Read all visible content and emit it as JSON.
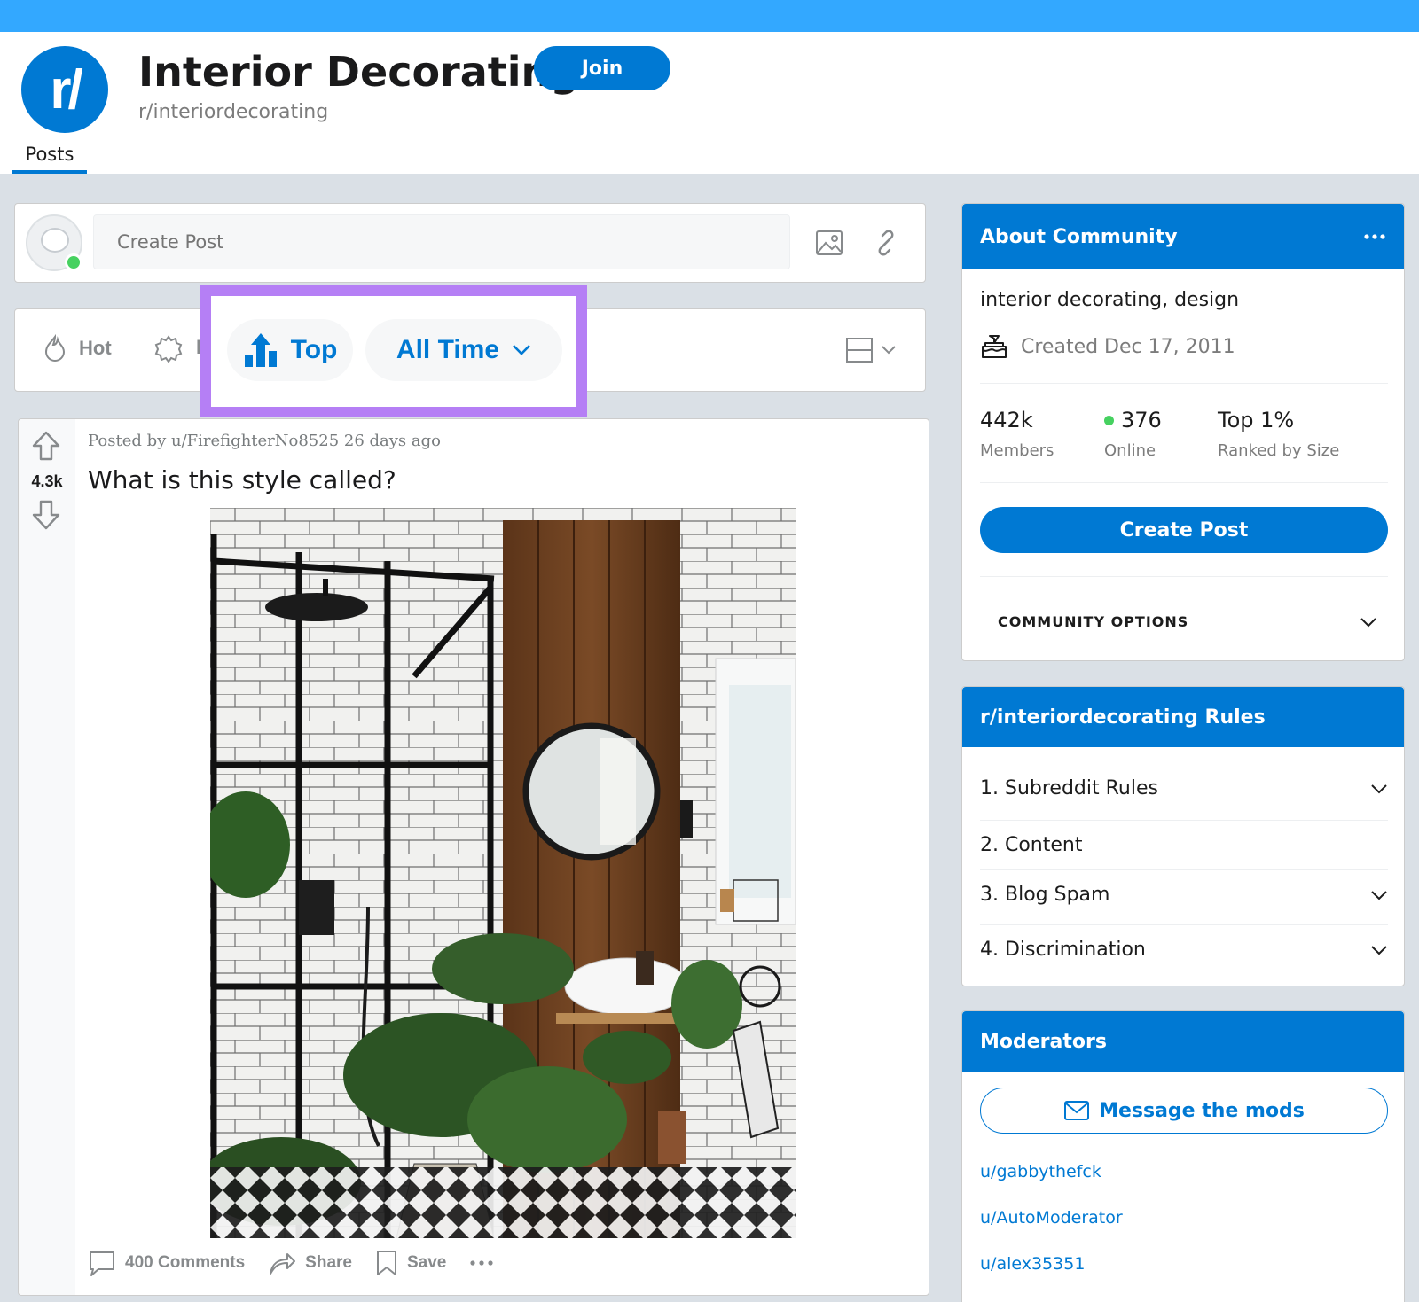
{
  "header": {
    "logo_text": "r/",
    "title": "Interior Decorating",
    "subreddit": "r/interiordecorating",
    "join_label": "Join",
    "tab_posts": "Posts"
  },
  "create_post": {
    "placeholder": "Create Post"
  },
  "sort": {
    "hot": "Hot",
    "new_partial": "N",
    "top": "Top",
    "time_range": "All Time"
  },
  "post": {
    "votes": "4.3k",
    "meta": "Posted by u/FirefighterNo8525 26 days ago",
    "title": "What is this style called?",
    "comments": "400 Comments",
    "share": "Share",
    "save": "Save"
  },
  "about": {
    "heading": "About Community",
    "description": "interior decorating, design",
    "created": "Created Dec 17, 2011",
    "members_value": "442k",
    "members_label": "Members",
    "online_value": "376",
    "online_label": "Online",
    "rank_value": "Top 1%",
    "rank_label": "Ranked by Size",
    "create_post_label": "Create Post",
    "community_options": "COMMUNITY OPTIONS"
  },
  "rules": {
    "heading": "r/interiordecorating Rules",
    "items": [
      {
        "label": "1. Subreddit Rules"
      },
      {
        "label": "2. Content"
      },
      {
        "label": "3. Blog Spam"
      },
      {
        "label": "4. Discrimination"
      }
    ]
  },
  "moderators": {
    "heading": "Moderators",
    "message_label": "Message the mods",
    "list": [
      "u/gabbythefck",
      "u/AutoModerator",
      "u/alex35351"
    ]
  },
  "colors": {
    "topbar": "#33a8ff",
    "brand_blue": "#0079d3",
    "highlight": "#b57ff5",
    "online_green": "#46d160"
  }
}
